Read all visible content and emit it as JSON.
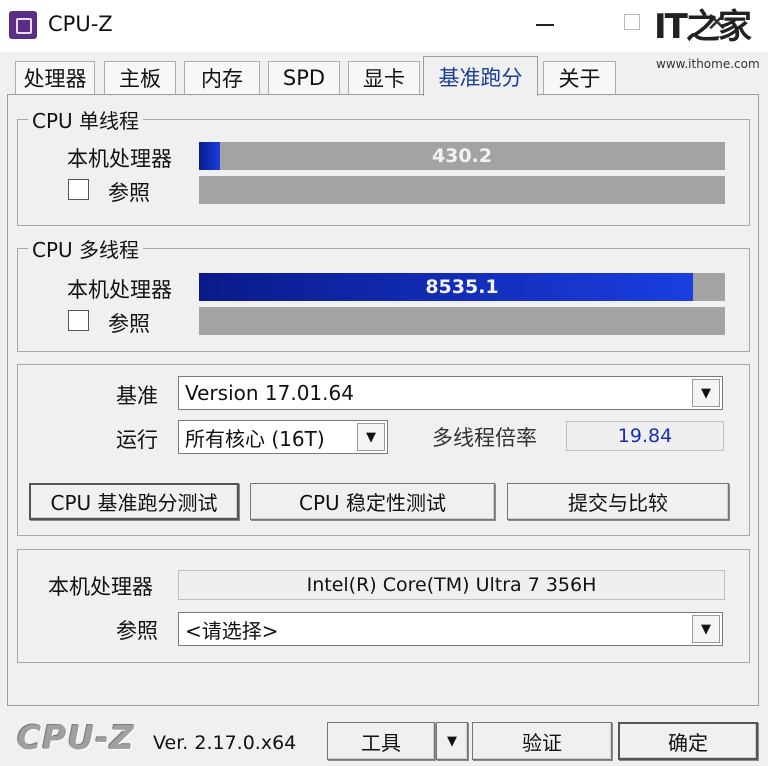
{
  "window": {
    "title": "CPU-Z",
    "close_glyph": "✕",
    "watermark": {
      "logo": "IT之家",
      "url": "www.ithome.com"
    }
  },
  "tabs": [
    {
      "label": "处理器",
      "active": false
    },
    {
      "label": "主板",
      "active": false
    },
    {
      "label": "内存",
      "active": false
    },
    {
      "label": "SPD",
      "active": false
    },
    {
      "label": "显卡",
      "active": false
    },
    {
      "label": "基准跑分",
      "active": true
    },
    {
      "label": "关于",
      "active": false
    }
  ],
  "single_thread": {
    "group_label": "CPU 单线程",
    "this_cpu_label": "本机处理器",
    "this_cpu_value": "430.2",
    "this_cpu_fill_fraction": 0.04,
    "reference_label": "参照",
    "reference_checked": false
  },
  "multi_thread": {
    "group_label": "CPU 多线程",
    "this_cpu_label": "本机处理器",
    "this_cpu_value": "8535.1",
    "this_cpu_fill_fraction": 0.94,
    "reference_label": "参照",
    "reference_checked": false
  },
  "settings": {
    "benchmark_label": "基准",
    "benchmark_value": "Version 17.01.64",
    "run_label": "运行",
    "run_value": "所有核心 (16T)",
    "ratio_label": "多线程倍率",
    "ratio_value": "19.84",
    "ratio_color": "#1a2fb0",
    "buttons": {
      "bench": "CPU 基准跑分测试",
      "stress": "CPU 稳定性测试",
      "submit": "提交与比较"
    }
  },
  "processor_info": {
    "this_cpu_label": "本机处理器",
    "this_cpu_name": "Intel(R) Core(TM) Ultra 7 356H",
    "reference_label": "参照",
    "reference_value": "<请选择>"
  },
  "footer": {
    "logo": "CPU-Z",
    "version": "Ver. 2.17.0.x64",
    "tools_label": "工具",
    "validate_label": "验证",
    "ok_label": "确定"
  },
  "colors": {
    "bar_fill_start": "#0a1a8a",
    "bar_fill_end": "#1a3ee0",
    "bar_background": "#a3a3a3",
    "active_tab_text": "#1a3d9a"
  },
  "icons": [
    "app-icon",
    "chevron-down-icon",
    "minimize-icon",
    "maximize-icon",
    "close-icon"
  ]
}
